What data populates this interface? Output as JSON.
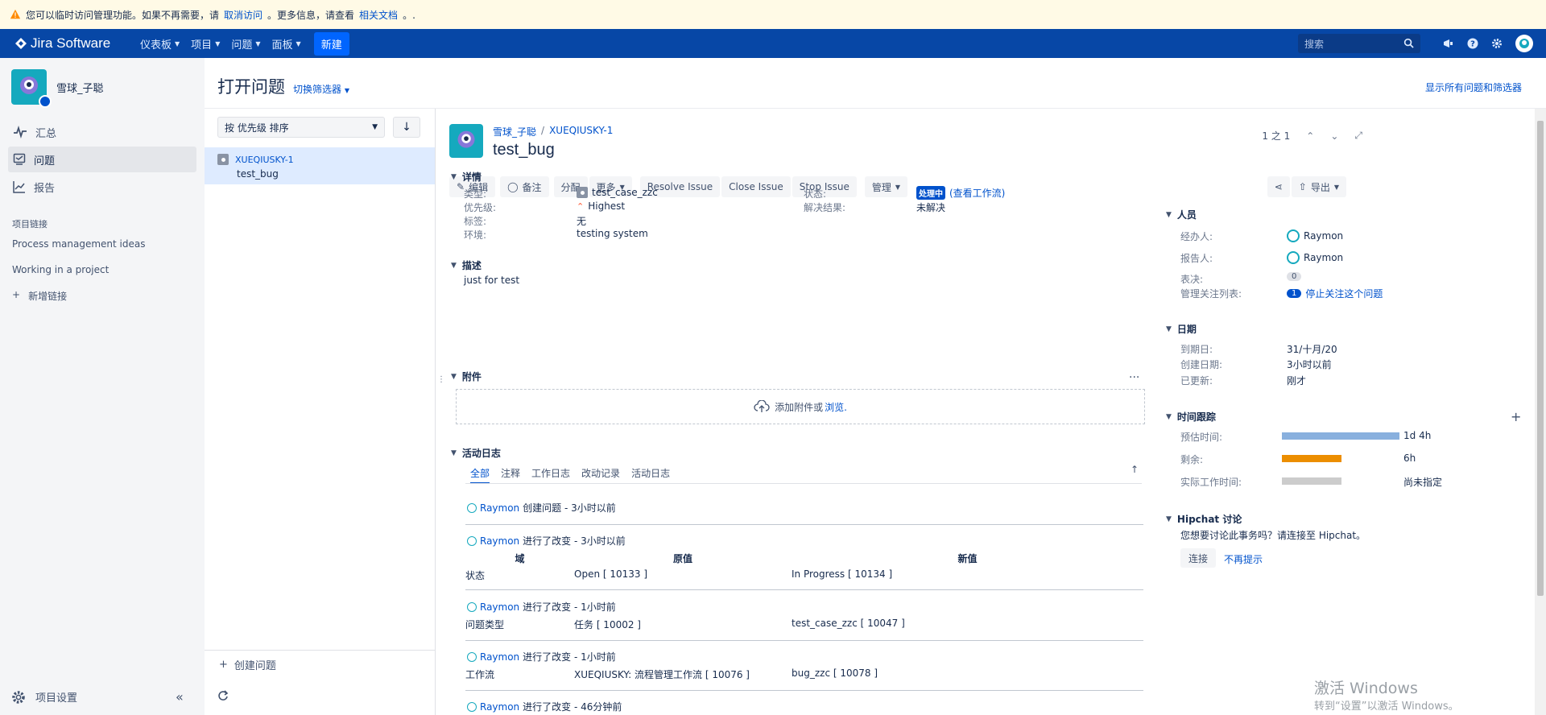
{
  "banner": {
    "text": "您可以临时访问管理功能。如果不再需要，请",
    "link1": "取消访问",
    "mid": "。更多信息，请查看",
    "link2": "相关文档",
    "end": "。."
  },
  "nav": {
    "logo": "Jira Software",
    "items": [
      "仪表板",
      "项目",
      "问题",
      "面板"
    ],
    "create": "新建",
    "search_placeholder": "搜索"
  },
  "sidebar": {
    "project_name": "雪球_子聪",
    "items": [
      {
        "label": "汇总",
        "icon": "pulse-icon"
      },
      {
        "label": "问题",
        "icon": "issues-icon"
      },
      {
        "label": "报告",
        "icon": "reports-icon"
      }
    ],
    "links_heading": "项目链接",
    "links": [
      "Process management ideas",
      "Working in a project"
    ],
    "add_link": "新增链接",
    "settings": "项目设置"
  },
  "header": {
    "title": "打开问题",
    "switch_filter": "切换筛选器",
    "show_all": "显示所有问题和筛选器"
  },
  "list": {
    "sort": "按 优先级 排序",
    "issues": [
      {
        "key": "XUEQIUSKY-1",
        "summary": "test_bug"
      }
    ],
    "create_issue": "创建问题"
  },
  "issue": {
    "project": "雪球_子聪",
    "key": "XUEQIUSKY-1",
    "summary": "test_bug",
    "pager": "1 之 1",
    "buttons": {
      "edit": "编辑",
      "comment": "备注",
      "assign": "分配",
      "more": "更多",
      "resolve": "Resolve Issue",
      "close": "Close Issue",
      "stop": "Stop Issue",
      "admin": "管理",
      "export": "导出"
    },
    "details": {
      "heading": "详情",
      "type_label": "类型:",
      "type_value": "test_case_zzc",
      "priority_label": "优先级:",
      "priority_value": "Highest",
      "labels_label": "标签:",
      "labels_value": "无",
      "env_label": "环境:",
      "env_value": "testing system",
      "status_label": "状态:",
      "status_value": "处理中",
      "workflow_link": "(查看工作流)",
      "resolution_label": "解决结果:",
      "resolution_value": "未解决"
    },
    "description": {
      "heading": "描述",
      "text": "just for test"
    },
    "attachments": {
      "heading": "附件",
      "drop": "添加附件或",
      "browse": "浏览."
    },
    "activity": {
      "heading": "活动日志",
      "tabs": [
        "全部",
        "注释",
        "工作日志",
        "改动记录",
        "活动日志"
      ],
      "col_field": "域",
      "col_old": "原值",
      "col_new": "新值",
      "entries": [
        {
          "user": "Raymon",
          "text": "创建问题 - 3小时以前"
        },
        {
          "user": "Raymon",
          "text": "进行了改变 - 3小时以前",
          "field": "状态",
          "old": "Open [ 10133 ]",
          "new": "In Progress [ 10134 ]"
        },
        {
          "user": "Raymon",
          "text": "进行了改变 - 1小时前",
          "field": "问题类型",
          "old": "任务 [ 10002 ]",
          "new": "test_case_zzc [ 10047 ]"
        },
        {
          "user": "Raymon",
          "text": "进行了改变 - 1小时前",
          "field": "工作流",
          "old": "XUEQIUSKY: 流程管理工作流 [ 10076 ]",
          "new": "bug_zzc [ 10078 ]"
        },
        {
          "user": "Raymon",
          "text": "进行了改变 - 46分钟前"
        }
      ]
    }
  },
  "people": {
    "heading": "人员",
    "assignee_label": "经办人:",
    "assignee": "Raymon",
    "reporter_label": "报告人:",
    "reporter": "Raymon",
    "votes_label": "表决:",
    "votes": "0",
    "watchers_label": "管理关注列表:",
    "watchers": "1",
    "watch_link": "停止关注这个问题"
  },
  "dates": {
    "heading": "日期",
    "due_label": "到期日:",
    "due": "31/十月/20",
    "created_label": "创建日期:",
    "created": "3小时以前",
    "updated_label": "已更新:",
    "updated": "刚才"
  },
  "time": {
    "heading": "时间跟踪",
    "estimated_label": "预估时间:",
    "estimated": "1d 4h",
    "estimated_fraction": 1.0,
    "remaining_label": "剩余:",
    "remaining": "6h",
    "remaining_fraction": 0.5,
    "logged_label": "实际工作时间:",
    "logged": "尚未指定",
    "logged_fraction": 0.0,
    "colors": {
      "estimated": "#89b0de",
      "remaining": "#ec8e00",
      "logged": "#cccccc"
    }
  },
  "hipchat": {
    "heading": "Hipchat 讨论",
    "text": "您想要讨论此事务吗？请连接至 Hipchat。",
    "connect": "连接",
    "dismiss": "不再提示"
  },
  "watermark": {
    "line1": "激活 Windows",
    "line2": "转到“设置”以激活 Windows。"
  }
}
